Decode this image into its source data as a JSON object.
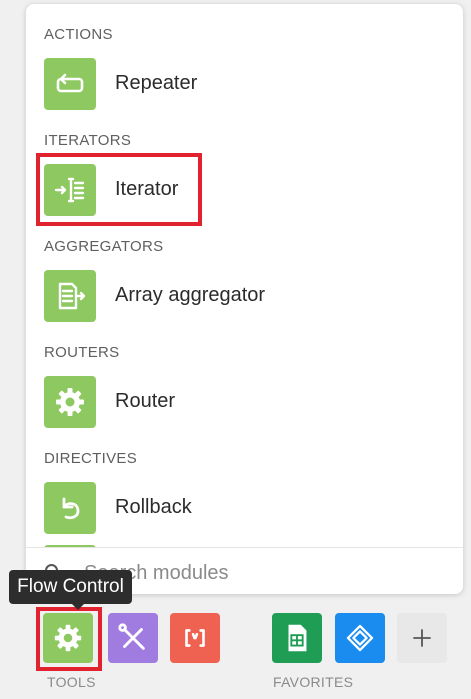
{
  "sections": [
    {
      "title": "ACTIONS",
      "items": [
        {
          "label": "Repeater",
          "icon": "repeat-icon"
        }
      ]
    },
    {
      "title": "ITERATORS",
      "items": [
        {
          "label": "Iterator",
          "icon": "iterator-icon"
        }
      ]
    },
    {
      "title": "AGGREGATORS",
      "items": [
        {
          "label": "Array aggregator",
          "icon": "array-aggregator-icon"
        }
      ]
    },
    {
      "title": "ROUTERS",
      "items": [
        {
          "label": "Router",
          "icon": "router-gear-icon"
        }
      ]
    },
    {
      "title": "DIRECTIVES",
      "items": [
        {
          "label": "Rollback",
          "icon": "rollback-icon"
        }
      ]
    }
  ],
  "search": {
    "placeholder": "Search modules"
  },
  "tooltip": {
    "text": "Flow Control"
  },
  "dock": {
    "tools_label": "TOOLS",
    "favorites_label": "FAVORITES",
    "tools": [
      {
        "name": "flow-control",
        "icon": "gear-icon",
        "color": "#8dc860"
      },
      {
        "name": "tools",
        "icon": "wrench-screwdriver-icon",
        "color": "#a17ce0"
      },
      {
        "name": "text-parser",
        "icon": "brackets-icon",
        "color": "#ef6150"
      }
    ],
    "favorites": [
      {
        "name": "google-sheets",
        "icon": "google-sheets-icon",
        "color": "#1f9d55"
      },
      {
        "name": "app-module",
        "icon": "diamond-app-icon",
        "color": "#1a8cf0"
      }
    ],
    "add_icon": "plus-icon"
  },
  "colors": {
    "module_green": "#8dc860",
    "highlight_red": "#e0232e",
    "tooltip_bg": "#2d2d2d"
  }
}
